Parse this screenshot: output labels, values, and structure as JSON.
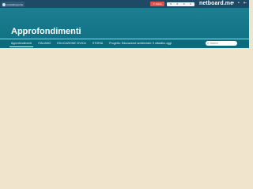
{
  "topbar": {
    "user_name": "cccaldetreportie",
    "share_icon": "share-icon",
    "share_label": "Salva",
    "counters": [
      "9",
      "0",
      "0",
      "0"
    ],
    "brand": "netboard.me",
    "icons": [
      "enter-icon",
      "bell-icon",
      "logout-icon"
    ]
  },
  "header": {
    "title": "Approfondimenti"
  },
  "nav": {
    "items": [
      {
        "label": "Approfondimenti",
        "active": true
      },
      {
        "label": "ITALIANO"
      },
      {
        "label": "EDUCAZIONE CIVICA"
      },
      {
        "label": "STORIA"
      },
      {
        "label": "Progetto: Educazione ambientale: Il cittadino oggi"
      }
    ]
  },
  "search": {
    "placeholder": "Search"
  },
  "colors": {
    "topbar": "#1e4a66",
    "header": "#117286",
    "nav": "#0b6a7c",
    "background": "#f1e4cc",
    "accent": "#e2524d"
  }
}
